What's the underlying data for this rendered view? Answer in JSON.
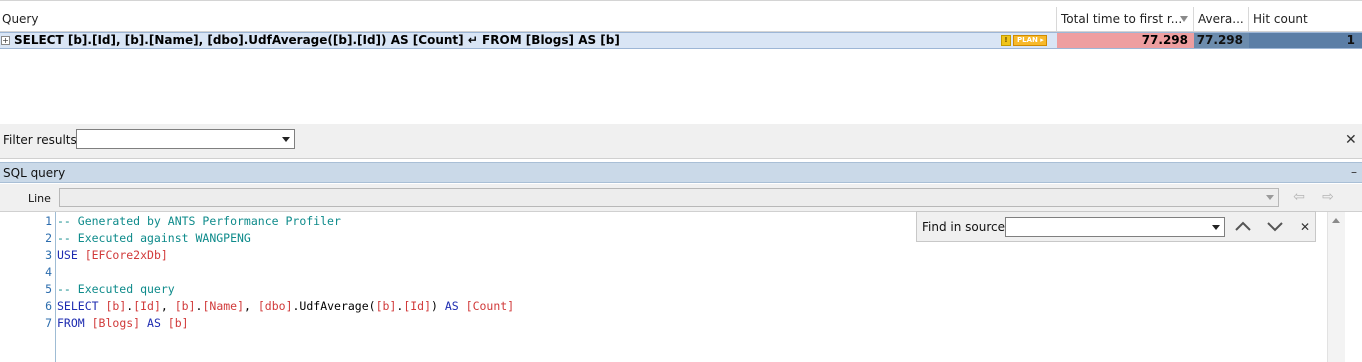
{
  "grid": {
    "columns": {
      "query": "Query",
      "total_time": "Total time to first r...",
      "average": "Avera...",
      "hit_count": "Hit count"
    },
    "rows": [
      {
        "expander": "+",
        "query": "SELECT [b].[Id], [b].[Name], [dbo].UdfAverage([b].[Id]) AS [Count] ↵ FROM [Blogs] AS [b]",
        "plan_label": "PLAN ▸",
        "total_time": "77.298",
        "average": "77.298",
        "hit_count": "1"
      }
    ]
  },
  "filter": {
    "label": "Filter results:",
    "value": "",
    "close": "✕"
  },
  "sql_panel": {
    "title": "SQL query",
    "collapse": "–",
    "line_label": "Line",
    "nav_back": "⇦",
    "nav_forward": "⇨"
  },
  "find": {
    "label": "Find in source:",
    "value": "",
    "close": "✕"
  },
  "code": [
    {
      "n": "1",
      "parts": [
        {
          "c": "cm",
          "t": "-- Generated by ANTS Performance Profiler"
        }
      ]
    },
    {
      "n": "2",
      "parts": [
        {
          "c": "cm",
          "t": "-- Executed against WANGPENG"
        }
      ]
    },
    {
      "n": "3",
      "parts": [
        {
          "c": "kw",
          "t": "USE "
        },
        {
          "c": "id",
          "t": "[EFCore2xDb]"
        }
      ]
    },
    {
      "n": "4",
      "parts": []
    },
    {
      "n": "5",
      "parts": [
        {
          "c": "cm",
          "t": "-- Executed query"
        }
      ]
    },
    {
      "n": "6",
      "parts": [
        {
          "c": "kw",
          "t": "SELECT "
        },
        {
          "c": "id",
          "t": "[b]"
        },
        {
          "c": "tx",
          "t": "."
        },
        {
          "c": "id",
          "t": "[Id]"
        },
        {
          "c": "tx",
          "t": ", "
        },
        {
          "c": "id",
          "t": "[b]"
        },
        {
          "c": "tx",
          "t": "."
        },
        {
          "c": "id",
          "t": "[Name]"
        },
        {
          "c": "tx",
          "t": ", "
        },
        {
          "c": "id",
          "t": "[dbo]"
        },
        {
          "c": "tx",
          "t": ".UdfAverage("
        },
        {
          "c": "id",
          "t": "[b]"
        },
        {
          "c": "tx",
          "t": "."
        },
        {
          "c": "id",
          "t": "[Id]"
        },
        {
          "c": "tx",
          "t": ") "
        },
        {
          "c": "kw",
          "t": "AS "
        },
        {
          "c": "id",
          "t": "[Count]"
        }
      ]
    },
    {
      "n": "7",
      "parts": [
        {
          "c": "kw",
          "t": "FROM "
        },
        {
          "c": "id",
          "t": "[Blogs]"
        },
        {
          "c": "kw",
          "t": " AS "
        },
        {
          "c": "id",
          "t": "[b]"
        }
      ]
    }
  ],
  "colors": {
    "selected_row": "#d9e5f5",
    "time_bar": "#ee9ea0",
    "average_bar": "#6c8cad",
    "hit_bar": "#5b7ea6",
    "comment": "#0e8b8b",
    "keyword": "#1d2bb0",
    "identifier": "#d13a3a"
  }
}
